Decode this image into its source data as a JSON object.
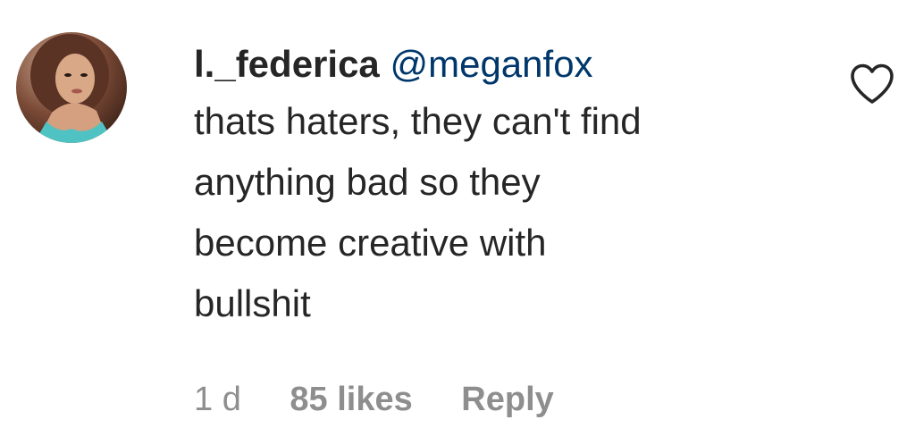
{
  "comment": {
    "username": "l._federica",
    "mention": "@meganfox",
    "text_lines": [
      "thats haters, they can't find",
      "anything bad so they",
      "become creative with",
      "bullshit"
    ],
    "time": "1 d",
    "likes": "85 likes",
    "reply_label": "Reply"
  },
  "icons": {
    "like": "heart-outline-icon",
    "avatar": "profile-photo"
  },
  "colors": {
    "text": "#262626",
    "mention": "#00376b",
    "meta": "#8e8e8e"
  }
}
